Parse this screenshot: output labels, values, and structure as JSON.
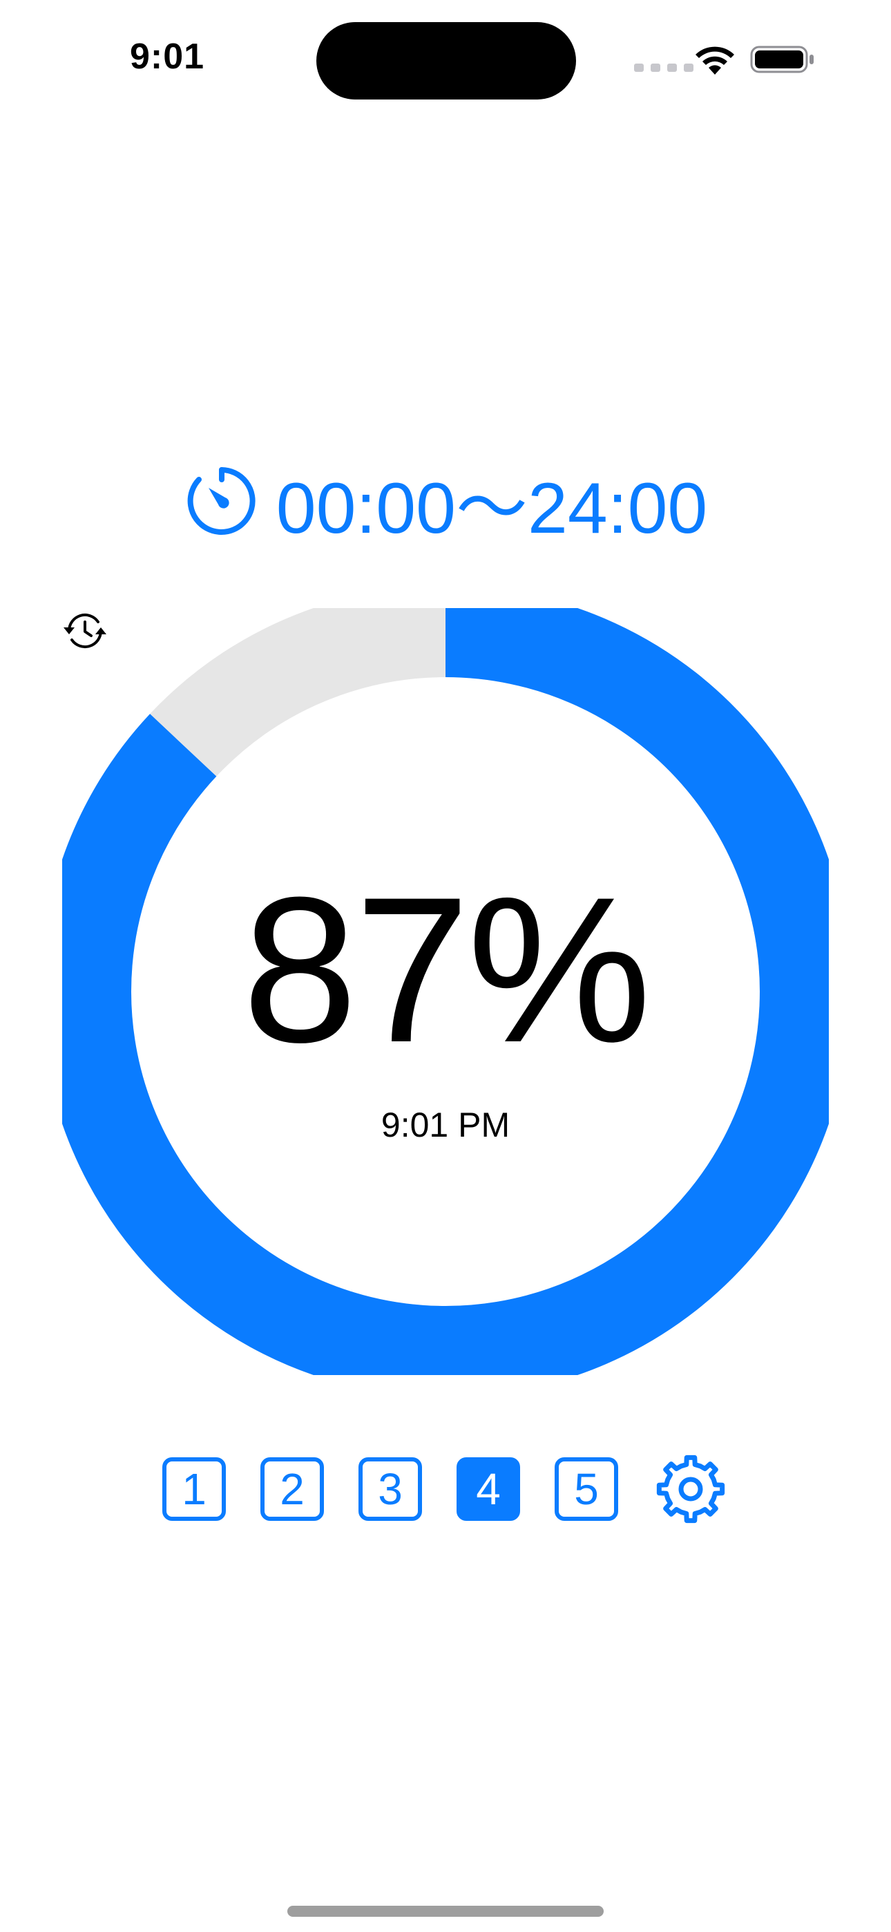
{
  "status_bar": {
    "time": "9:01"
  },
  "range": {
    "text": "00:00～24:00",
    "icon": "timer-icon"
  },
  "gauge": {
    "percent_text": "87%",
    "fraction": 0.87,
    "updated_time": "9:01 PM",
    "updated_icon": "history-icon"
  },
  "pages": {
    "items": [
      "1",
      "2",
      "3",
      "4",
      "5"
    ],
    "active": "4",
    "settings_icon": "gear-icon"
  },
  "colors": {
    "accent": "#0a7cff",
    "track": "#e6e6e6"
  }
}
